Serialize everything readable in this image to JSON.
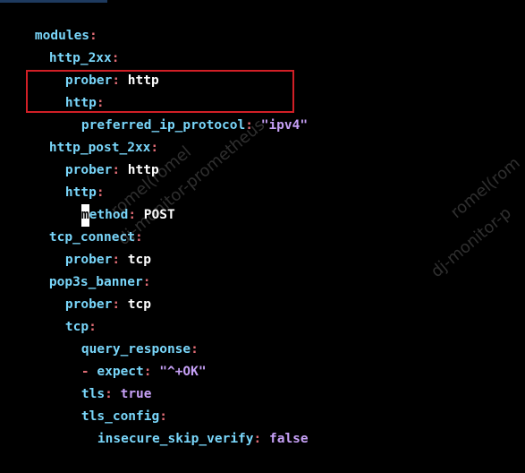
{
  "watermarks": {
    "line1": "romel(romel",
    "line2": "dj-monitor-prometheus",
    "line3": "romel(rom",
    "line4": "dj-monitor-p"
  },
  "colors": {
    "background": "#000000",
    "key": "#79d6fa",
    "colon": "#e06c75",
    "value": "#ffffff",
    "string": "#c6a0f6",
    "highlight_border": "#d11f26"
  },
  "code": {
    "l1": {
      "key": "modules",
      "colon": ":"
    },
    "l2": {
      "key": "http_2xx",
      "colon": ":"
    },
    "l3": {
      "key": "prober",
      "colon": ":",
      "value": " http"
    },
    "l4": {
      "key": "http",
      "colon": ":"
    },
    "l5": {
      "key": "preferred_ip_protocol",
      "colon": ":",
      "value": " \"ipv4\""
    },
    "l6": {
      "key": "http_post_2xx",
      "colon": ":"
    },
    "l7": {
      "key": "prober",
      "colon": ":",
      "value": " http"
    },
    "l8": {
      "key": "http",
      "colon": ":"
    },
    "l9": {
      "cursor_char": "m",
      "key": "ethod",
      "colon": ":",
      "value": " POST"
    },
    "l10": {
      "key": "tcp_connect",
      "colon": ":"
    },
    "l11": {
      "key": "prober",
      "colon": ":",
      "value": " tcp"
    },
    "l12": {
      "key": "pop3s_banner",
      "colon": ":"
    },
    "l13": {
      "key": "prober",
      "colon": ":",
      "value": " tcp"
    },
    "l14": {
      "key": "tcp",
      "colon": ":"
    },
    "l15": {
      "key": "query_response",
      "colon": ":"
    },
    "l16": {
      "dash": "- ",
      "key": "expect",
      "colon": ":",
      "value": " \"^+OK\""
    },
    "l17": {
      "key": "tls",
      "colon": ":",
      "value": " true"
    },
    "l18": {
      "key": "tls_config",
      "colon": ":"
    },
    "l19": {
      "key": "insecure_skip_verify",
      "colon": ":",
      "value": " false"
    }
  }
}
